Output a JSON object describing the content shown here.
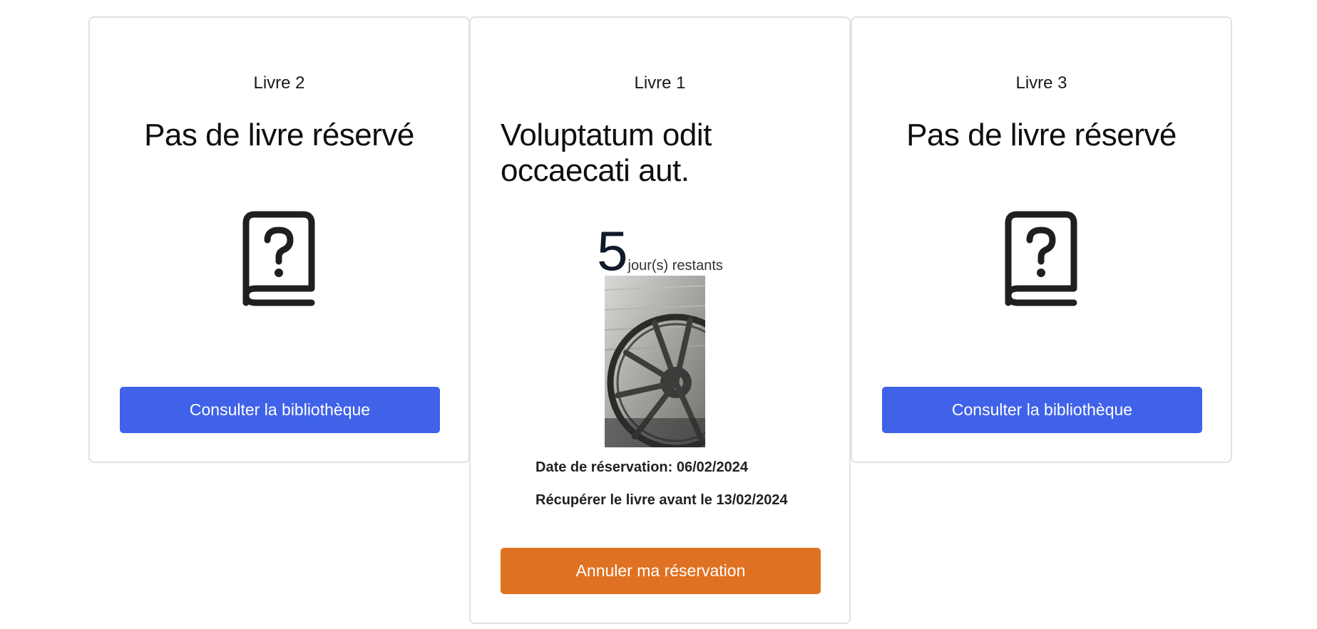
{
  "cards": {
    "left": {
      "subtitle": "Livre 2",
      "title": "Pas de livre réservé",
      "icon": "book-question-icon",
      "button_label": "Consulter la bibliothèque"
    },
    "middle": {
      "subtitle": "Livre 1",
      "title": "Voluptatum odit occaecati aut.",
      "days_remaining": "5",
      "days_label": "jour(s) restants",
      "reservation_date": "Date de réservation: 06/02/2024",
      "pickup_before": "Récupérer le livre avant le 13/02/2024",
      "button_label": "Annuler ma réservation"
    },
    "right": {
      "subtitle": "Livre 3",
      "title": "Pas de livre réservé",
      "icon": "book-question-icon",
      "button_label": "Consulter la bibliothèque"
    }
  },
  "colors": {
    "primary_button": "#4062e8",
    "cancel_button": "#df7222",
    "card_border": "#e2e2e2"
  }
}
